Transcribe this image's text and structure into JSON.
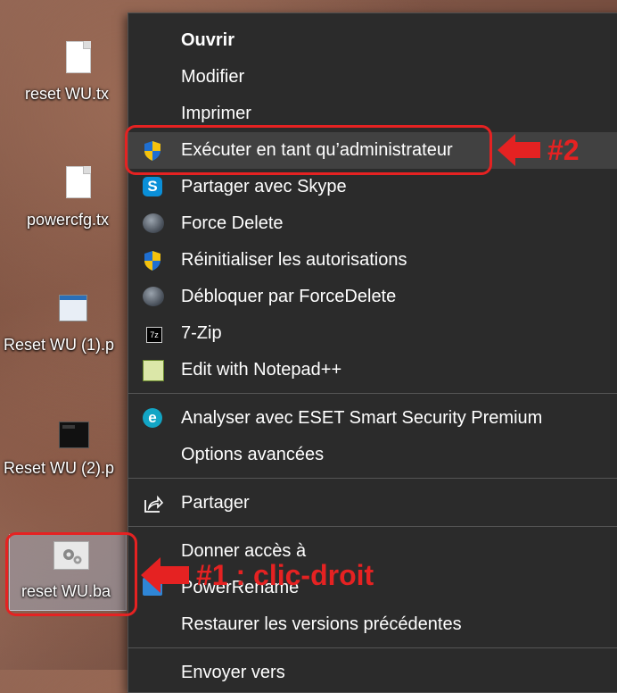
{
  "desktop": {
    "icons": [
      {
        "label": "reset WU.tx",
        "icon": "text-file-icon"
      },
      {
        "label": "powercfg.tx",
        "icon": "text-file-icon"
      },
      {
        "label": "Reset WU (1).p",
        "icon": "image-file-icon"
      },
      {
        "label": "Reset WU (2).p",
        "icon": "image-file-icon"
      },
      {
        "label": "reset WU.ba",
        "icon": "batch-file-icon"
      }
    ]
  },
  "context_menu": {
    "items": [
      {
        "label": "Ouvrir",
        "icon": null,
        "bold": true
      },
      {
        "label": "Modifier",
        "icon": null
      },
      {
        "label": "Imprimer",
        "icon": null
      },
      {
        "label": "Exécuter en tant qu’administrateur",
        "icon": "uac-shield-icon",
        "highlighted": true
      },
      {
        "label": "Partager avec Skype",
        "icon": "skype-icon"
      },
      {
        "label": "Force Delete",
        "icon": "force-delete-icon"
      },
      {
        "label": "Réinitialiser les autorisations",
        "icon": "uac-shield-icon"
      },
      {
        "label": "Débloquer par ForceDelete",
        "icon": "force-delete-icon"
      },
      {
        "label": "7-Zip",
        "icon": "7zip-icon"
      },
      {
        "label": "Edit with Notepad++",
        "icon": "notepad-plus-plus-icon"
      },
      {
        "label": "Analyser avec ESET Smart Security Premium",
        "icon": "eset-icon"
      },
      {
        "label": "Options avancées",
        "icon": null
      },
      {
        "label": "Partager",
        "icon": "share-icon"
      },
      {
        "label": "Donner accès à",
        "icon": null
      },
      {
        "label": "PowerRename",
        "icon": "powerrename-icon"
      },
      {
        "label": "Restaurer les versions précédentes",
        "icon": null
      },
      {
        "label": "Envoyer vers",
        "icon": null
      }
    ]
  },
  "annotations": {
    "step2": "#2",
    "step1": "#1 : clic-droit"
  },
  "colors": {
    "annotation": "#e52222",
    "menu_bg": "#2b2b2b",
    "menu_hover": "#414141"
  }
}
